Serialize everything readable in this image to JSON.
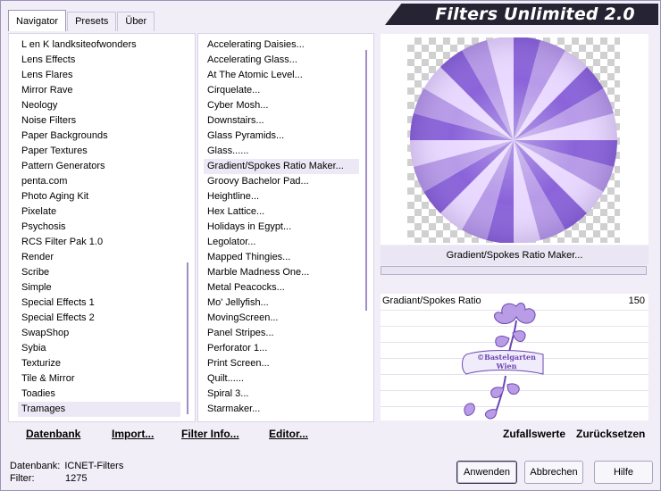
{
  "title": "Filters Unlimited 2.0",
  "tabs": [
    {
      "label": "Navigator"
    },
    {
      "label": "Presets"
    },
    {
      "label": "Über"
    }
  ],
  "categories": [
    "L en K landksiteofwonders",
    "Lens Effects",
    "Lens Flares",
    "Mirror Rave",
    "Neology",
    "Noise Filters",
    "Paper Backgrounds",
    "Paper Textures",
    "Pattern Generators",
    "penta.com",
    "Photo Aging Kit",
    "Pixelate",
    "Psychosis",
    "RCS Filter Pak 1.0",
    "Render",
    "Scribe",
    "Simple",
    "Special Effects 1",
    "Special Effects 2",
    "SwapShop",
    "Sybia",
    "Texturize",
    "Tile & Mirror",
    "Toadies",
    "Tramages"
  ],
  "selected_category": "Tramages",
  "filters": [
    "Accelerating Daisies...",
    "Accelerating Glass...",
    "At The Atomic Level...",
    "Cirquelate...",
    "Cyber Mosh...",
    "Downstairs...",
    "Glass Pyramids...",
    "Glass......",
    "Gradient/Spokes Ratio Maker...",
    "Groovy Bachelor Pad...",
    "Heightline...",
    "Hex Lattice...",
    "Holidays in Egypt...",
    "Legolator...",
    "Mapped Thingies...",
    "Marble Madness One...",
    "Metal Peacocks...",
    "Mo' Jellyfish...",
    "MovingScreen...",
    "Panel Stripes...",
    "Perforator 1...",
    "Print Screen...",
    "Quilt......",
    "Spiral 3...",
    "Starmaker..."
  ],
  "selected_filter": "Gradient/Spokes Ratio Maker...",
  "preview_filter_name": "Gradient/Spokes Ratio Maker...",
  "parameter": {
    "label": "Gradiant/Spokes Ratio",
    "value": "150"
  },
  "watermark": "©Bastelgarten Wien",
  "bottom_links": {
    "datenbank": "Datenbank",
    "import": "Import...",
    "filter_info": "Filter Info...",
    "editor": "Editor...",
    "random": "Zufallswerte",
    "reset": "Zurücksetzen"
  },
  "status": {
    "db_label": "Datenbank:",
    "db_value": "ICNET-Filters",
    "filter_label": "Filter:",
    "filter_value": "1275"
  },
  "buttons": {
    "apply": "Anwenden",
    "cancel": "Abbrechen",
    "help": "Hilfe"
  },
  "colors": {
    "accent": "#a08ec7",
    "spoke_dark": "#8a63d9",
    "spoke_light": "#e9d8ff",
    "banner": "#262333"
  }
}
